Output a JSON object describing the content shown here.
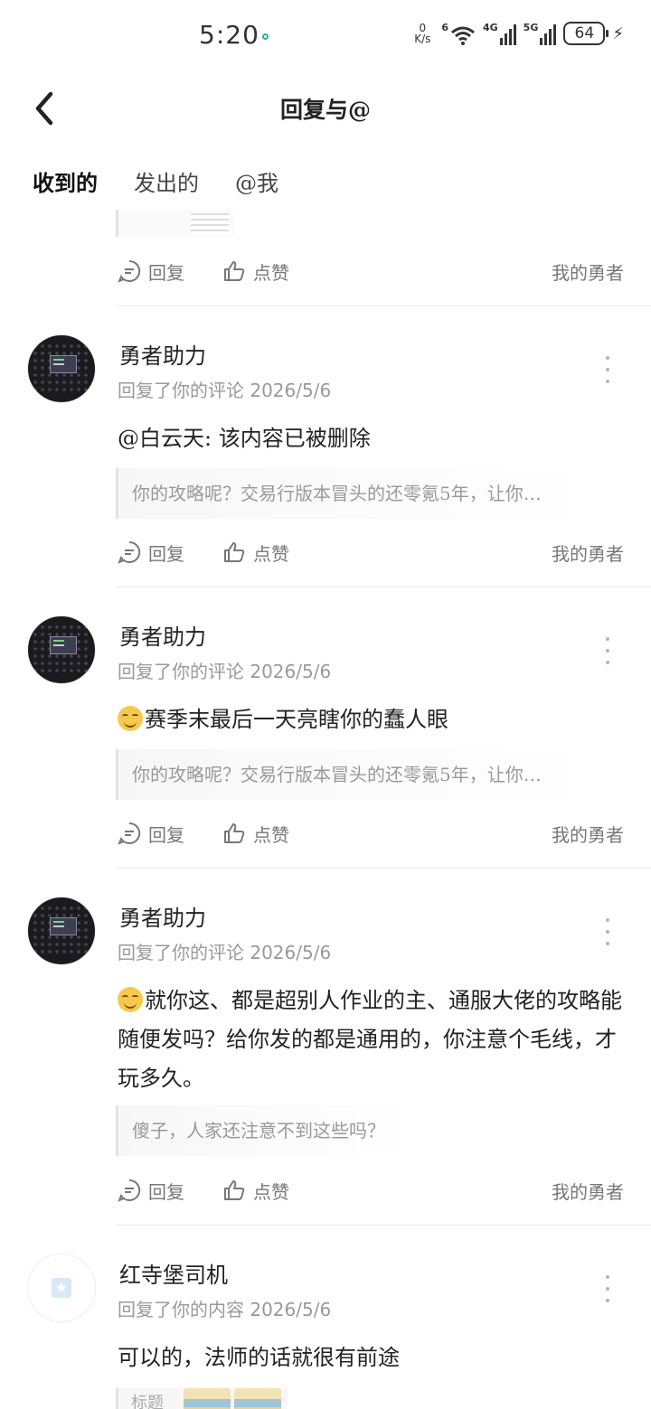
{
  "status_bar": {
    "time": "5:20",
    "net_speed_value": "0",
    "net_speed_unit": "K/s",
    "wifi_badge": "6",
    "signal1_label": "4G",
    "signal2_label": "5G",
    "battery": "64",
    "charging_icon": "lightning-icon"
  },
  "header": {
    "title": "回复与@",
    "back_icon": "back-arrow-icon"
  },
  "tabs": [
    {
      "label": "收到的",
      "active": true
    },
    {
      "label": "发出的",
      "active": false
    },
    {
      "label": "@我",
      "active": false
    }
  ],
  "actions": {
    "reply": "回复",
    "like": "点赞"
  },
  "comments": [
    {
      "name": "勇者助力",
      "action": "回复了你的评论",
      "date": "2026/5/6",
      "body": "@白云天: 该内容已被删除",
      "quote": "你的攻略呢？交易行版本冒头的还零氪5年，让你…",
      "source": "我的勇者"
    },
    {
      "name": "勇者助力",
      "action": "回复了你的评论",
      "date": "2026/5/6",
      "body": "赛季末最后一天亮瞎你的蠢人眼",
      "quote": "你的攻略呢？交易行版本冒头的还零氪5年，让你…",
      "source": "我的勇者"
    },
    {
      "name": "勇者助力",
      "action": "回复了你的评论",
      "date": "2026/5/6",
      "body": "就你这、都是超别人作业的主、通服大佬的攻略能随便发吗？给你发的都是通用的，你注意个毛线，才玩多久。",
      "quote": "傻子，人家还注意不到这些吗？",
      "source": "我的勇者"
    },
    {
      "name": "红寺堡司机",
      "action": "回复了你的内容",
      "date": "2026/5/6",
      "body": "可以的，法师的话就很有前途",
      "quote": "标题"
    }
  ],
  "top_item": {
    "source": "我的勇者"
  },
  "colors": {
    "accent": "#1fc0b0",
    "meta_gray": "#999999"
  }
}
